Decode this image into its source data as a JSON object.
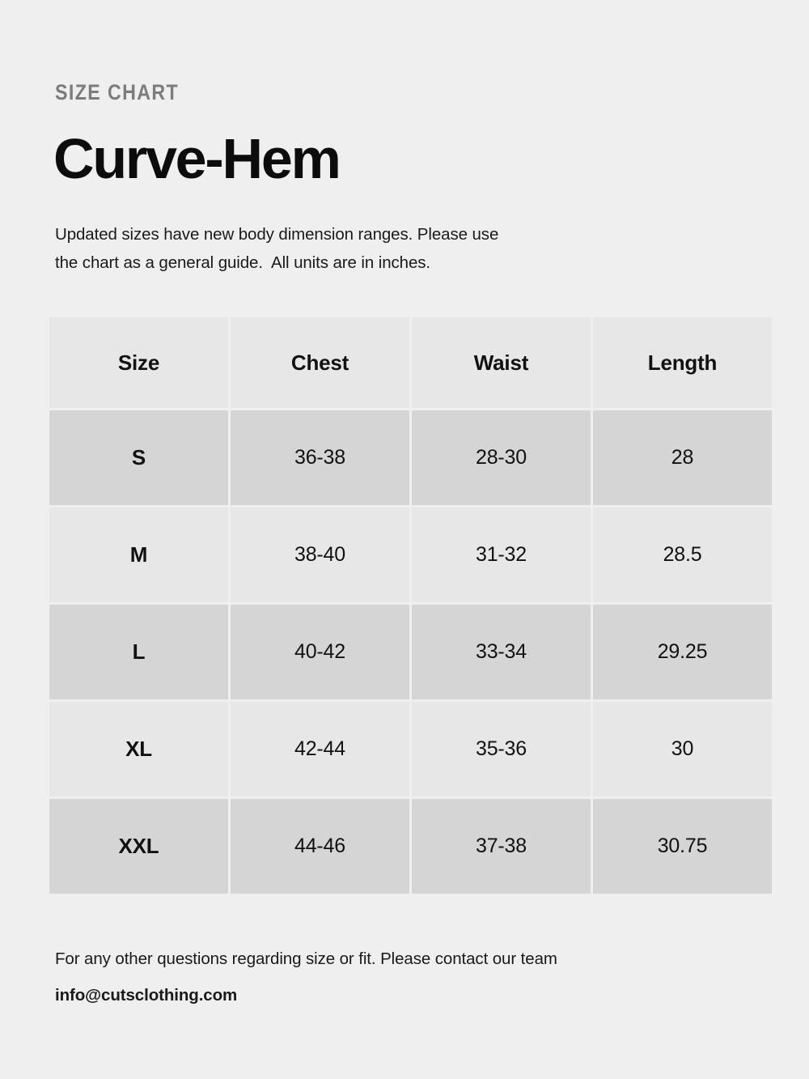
{
  "header": {
    "eyebrow": "SIZE CHART",
    "title": "Curve-Hem",
    "intro_line_1": "Updated sizes have new body dimension ranges. Please use",
    "intro_line_2": "the chart as a general guide.  All units are in inches."
  },
  "table": {
    "columns": [
      "Size",
      "Chest",
      "Waist",
      "Length"
    ],
    "rows": [
      {
        "size": "S",
        "chest": "36-38",
        "waist": "28-30",
        "length": "28"
      },
      {
        "size": "M",
        "chest": "38-40",
        "waist": "31-32",
        "length": "28.5"
      },
      {
        "size": "L",
        "chest": "40-42",
        "waist": "33-34",
        "length": "29.25"
      },
      {
        "size": "XL",
        "chest": "42-44",
        "waist": "35-36",
        "length": "30"
      },
      {
        "size": "XXL",
        "chest": "44-46",
        "waist": "37-38",
        "length": "30.75"
      }
    ]
  },
  "footer": {
    "note": "For any other questions regarding size or fit. Please contact our team",
    "email": "info@cutsclothing.com"
  },
  "colors": {
    "page_background": "#f0efef",
    "row_dark": "#d6d5d5",
    "row_light": "#e8e7e7",
    "eyebrow_text": "#7c7c7c",
    "body_text": "#111111"
  }
}
